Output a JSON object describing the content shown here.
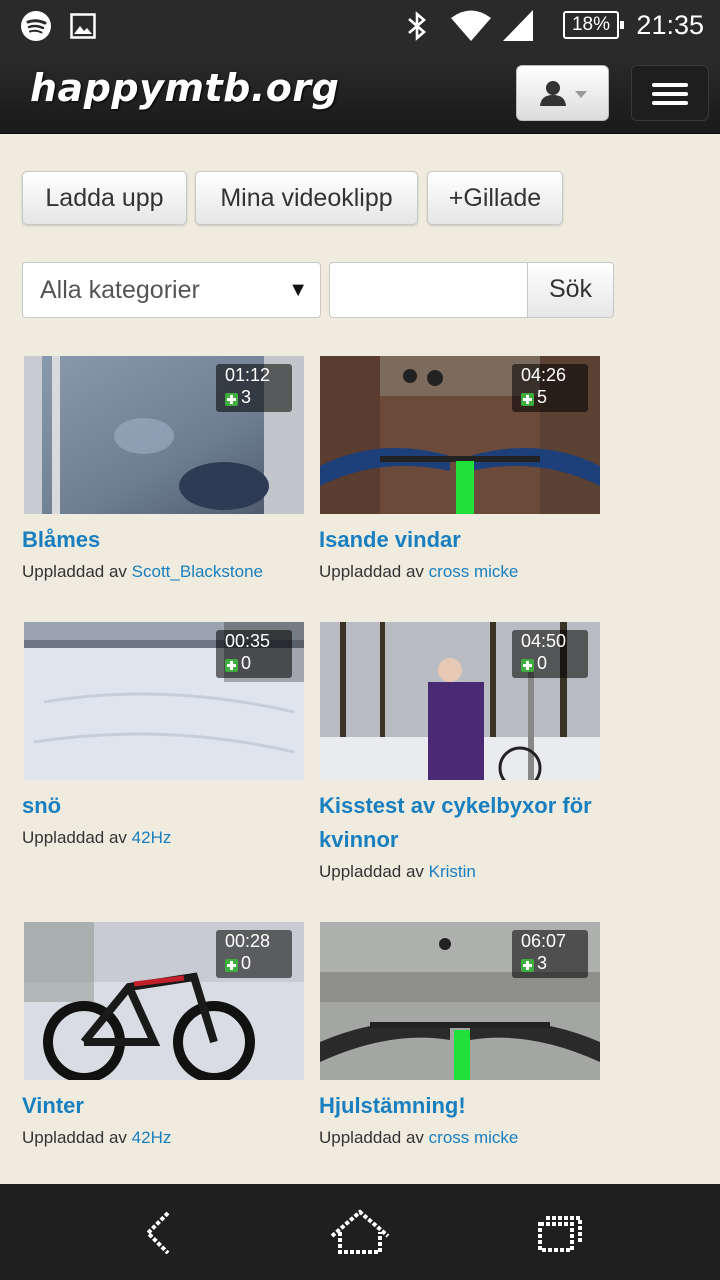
{
  "status_bar": {
    "icons": [
      "spotify-icon",
      "image-icon",
      "bluetooth-icon",
      "wifi-icon",
      "signal-icon"
    ],
    "battery": "18%",
    "time": "21:35"
  },
  "header": {
    "logo": "happymtb.org",
    "user_menu_icon": "user-icon",
    "menu_icon": "hamburger-menu-icon"
  },
  "actions": {
    "upload": "Ladda upp",
    "my_videos": "Mina videoklipp",
    "liked": "+Gillade"
  },
  "filter": {
    "category": "Alla kategorier",
    "search_value": "",
    "search_button": "Sök"
  },
  "videos": [
    {
      "title": "Blåmes",
      "duration": "01:12",
      "likes": "3",
      "uploaded_prefix": "Uppladdad av",
      "uploader": "Scott_Blackstone"
    },
    {
      "title": "Isande vindar",
      "duration": "04:26",
      "likes": "5",
      "uploaded_prefix": "Uppladdad av",
      "uploader": "cross micke"
    },
    {
      "title": "snö",
      "duration": "00:35",
      "likes": "0",
      "uploaded_prefix": "Uppladdad av",
      "uploader": "42Hz"
    },
    {
      "title": "Kisstest av cykelbyxor för kvinnor",
      "duration": "04:50",
      "likes": "0",
      "uploaded_prefix": "Uppladdad av",
      "uploader": "Kristin"
    },
    {
      "title": "Vinter",
      "duration": "00:28",
      "likes": "0",
      "uploaded_prefix": "Uppladdad av",
      "uploader": "42Hz"
    },
    {
      "title": "Hjulstämning!",
      "duration": "06:07",
      "likes": "3",
      "uploaded_prefix": "Uppladdad av",
      "uploader": "cross micke"
    }
  ],
  "nav": {
    "back_icon": "back-icon",
    "home_icon": "home-icon",
    "recents_icon": "recents-icon"
  },
  "colors": {
    "page_bg": "#efebdf",
    "link": "#1a7fbf",
    "navbar": "#222222"
  }
}
